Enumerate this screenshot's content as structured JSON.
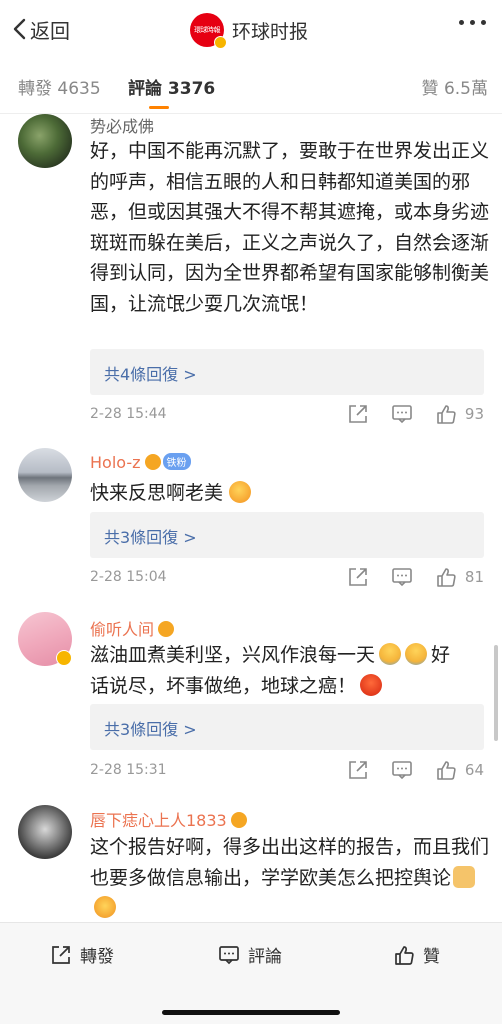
{
  "nav": {
    "back_label": "返回",
    "brand_logo_text": "環球時報",
    "brand_name": "环球时报"
  },
  "tabs": {
    "repost": "轉發 4635",
    "comments": "評論 3376",
    "likes": "贊 6.5萬",
    "active_color": "#ff8200"
  },
  "comments": [
    {
      "username": "势必成佛",
      "text": "好，中国不能再沉默了，要敢于在世界发出正义的呼声，相信五眼的人和日韩都知道美国的邪恶，但或因其强大不得不帮其遮掩，或本身劣迹斑斑而躲在美后，正义之声说久了，自然会逐渐得到认同，因为全世界都希望有国家能够制衡美国，让流氓少耍几次流氓！",
      "replies_label": "共4條回復 >",
      "time": "2-28 15:44",
      "like_count": "93"
    },
    {
      "username": "Holo-z",
      "fan_badge": "铁粉",
      "text": "快来反思啊老美",
      "replies_label": "共3條回復 >",
      "time": "2-28 15:04",
      "like_count": "81"
    },
    {
      "username": "偷听人间",
      "text_line1": "滋油皿煮美利坚，兴风作浪每一天",
      "text_line1_end": "好",
      "text_line2": "话说尽，坏事做绝，地球之癌！",
      "replies_label": "共3條回復 >",
      "time": "2-28 15:31",
      "like_count": "64"
    },
    {
      "username": "唇下痣心上人1833",
      "text": "这个报告好啊，得多出出这样的报告，而且我们也要多做信息输出，学学欧美怎么把控舆论"
    }
  ],
  "bottom_bar": {
    "repost": "轉發",
    "comment": "評論",
    "like": "贊"
  },
  "colors": {
    "link": "#4a6ea9",
    "username": "#eb7350",
    "brand": "#e60012"
  }
}
